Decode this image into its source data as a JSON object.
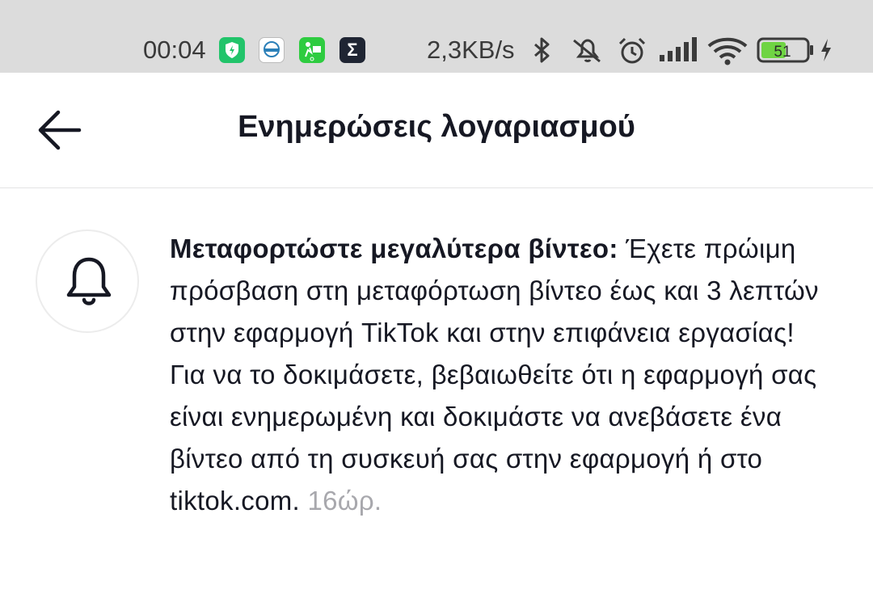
{
  "status_bar": {
    "time": "00:04",
    "network_speed": "2,3KB/s",
    "battery_level": "51",
    "apps": [
      "shield-app-icon",
      "news-app-icon",
      "fitness-app-icon",
      "sigma-app-icon"
    ],
    "sigma_glyph": "Σ",
    "icons": [
      "bluetooth-icon",
      "mute-icon",
      "alarm-icon",
      "signal-icon",
      "wifi-icon",
      "battery-icon",
      "charging-icon"
    ]
  },
  "header": {
    "title": "Ενημερώσεις λογαριασμού",
    "back_icon": "back-arrow-icon"
  },
  "notification": {
    "icon": "bell-icon",
    "title": "Μεταφορτώστε μεγαλύτερα βίντεο:",
    "body": "Έχετε πρώιμη πρόσβαση στη μεταφόρτωση βίντεο έως και 3 λεπτών στην εφαρμογή TikTok και στην επιφάνεια εργασίας! Για να το δοκιμάσετε, βεβαιωθείτε ότι η εφαρμογή σας είναι ενημερωμένη και δοκιμάστε να ανεβάσετε ένα βίντεο από τη συσκευή σας στην εφαρμογή ή στο tiktok.com.",
    "time": "16ώρ."
  },
  "colors": {
    "text_primary": "#161823",
    "text_secondary": "#a8a8ad",
    "status_bar_bg": "#dcdcdc",
    "battery_fill": "#6fd443"
  }
}
